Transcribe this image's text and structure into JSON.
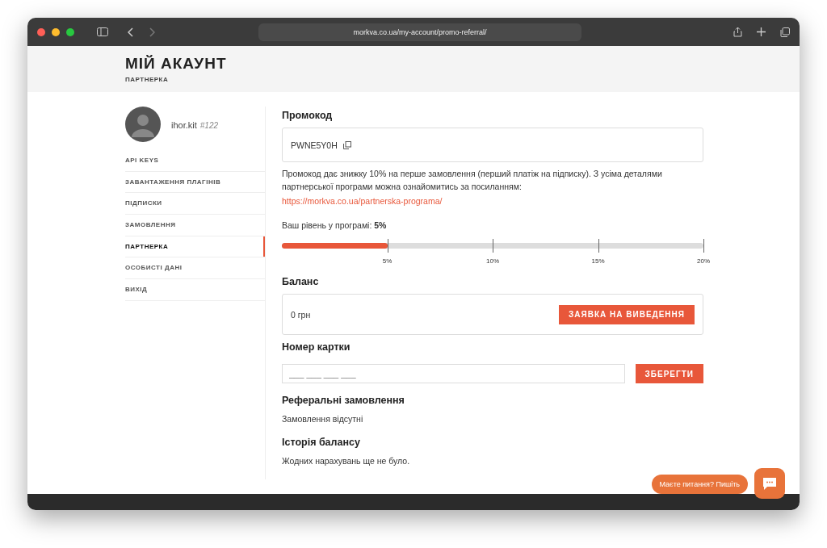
{
  "browser": {
    "url": "morkva.co.ua/my-account/promo-referral/"
  },
  "header": {
    "title": "МІЙ АКАУНТ",
    "subtitle": "ПАРТНЕРКА"
  },
  "user": {
    "name": "ihor.kit",
    "id": "#122"
  },
  "sidebar": {
    "items": [
      {
        "label": "API KEYS",
        "selected": false
      },
      {
        "label": "ЗАВАНТАЖЕННЯ ПЛАГІНІВ",
        "selected": false
      },
      {
        "label": "ПІДПИСКИ",
        "selected": false
      },
      {
        "label": "ЗАМОВЛЕННЯ",
        "selected": false
      },
      {
        "label": "ПАРТНЕРКА",
        "selected": true
      },
      {
        "label": "ОСОБИСТІ ДАНІ",
        "selected": false
      },
      {
        "label": "ВИХІД",
        "selected": false
      }
    ]
  },
  "promo": {
    "heading": "Промокод",
    "code": "PWNE5Y0H",
    "description": "Промокод дає знижку 10% на перше замовлення (перший платіж на підписку). З усіма деталями партнерської програми можна ознайомитись за посиланням:",
    "link": "https://morkva.co.ua/partnerska-programa/"
  },
  "level": {
    "label": "Ваш рівень у програмі: **5%**",
    "level": 0.25,
    "ticks": [
      "5%",
      "10%",
      "15%",
      "20%"
    ]
  },
  "balance": {
    "heading": "Баланс",
    "amount": "0 грн",
    "button": "ЗАЯВКА НА ВИВЕДЕННЯ"
  },
  "card": {
    "heading": "Номер картки",
    "placeholder": "___ ___ ___ ___",
    "button": "ЗБЕРЕГТИ"
  },
  "referrals": {
    "heading": "Реферальні замовлення",
    "text": "Замовлення відсутні"
  },
  "history": {
    "heading": "Історія балансу",
    "text": "Жодних нарахувань ще не було."
  },
  "chat": {
    "label": "Маєте питання? Пишіть"
  }
}
